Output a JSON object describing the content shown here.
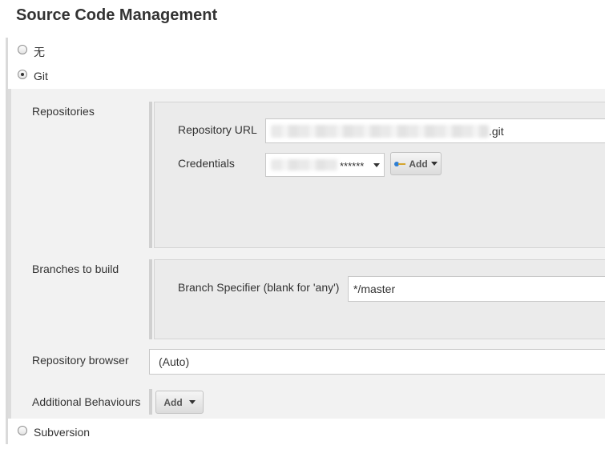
{
  "section_title": "Source Code Management",
  "scm_options": {
    "none": {
      "label": "无",
      "selected": false
    },
    "git": {
      "label": "Git",
      "selected": true
    },
    "subversion": {
      "label": "Subversion",
      "selected": false
    }
  },
  "repositories": {
    "label": "Repositories",
    "url_label": "Repository URL",
    "url_value_suffix": ".git",
    "credentials_label": "Credentials",
    "credentials_value": "******",
    "add_button": "Add"
  },
  "branches": {
    "label": "Branches to build",
    "specifier_label": "Branch Specifier (blank for 'any')",
    "specifier_value": "*/master"
  },
  "repository_browser": {
    "label": "Repository browser",
    "value": "(Auto)"
  },
  "additional_behaviours": {
    "label": "Additional Behaviours",
    "add_button": "Add"
  }
}
